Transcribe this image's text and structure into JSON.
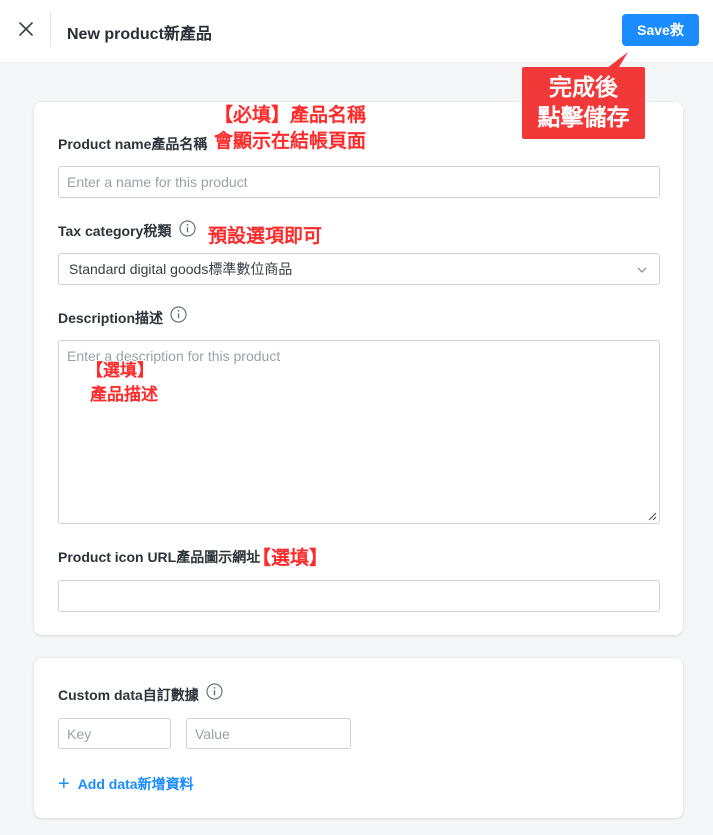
{
  "header": {
    "title": "New product新產品",
    "save_label": "Save救"
  },
  "form": {
    "product_name": {
      "label": "Product name產品名稱",
      "placeholder": "Enter a name for this product",
      "value": ""
    },
    "tax_category": {
      "label": "Tax category稅類",
      "selected": "Standard digital goods標準數位商品"
    },
    "description": {
      "label": "Description描述",
      "placeholder": "Enter a description for this product",
      "value": ""
    },
    "icon_url": {
      "label": "Product icon URL產品圖示網址",
      "value": ""
    }
  },
  "custom_data": {
    "label": "Custom data自訂數據",
    "key_placeholder": "Key",
    "value_placeholder": "Value",
    "add_label": "Add data新增資料"
  },
  "annotations": {
    "save_callout_line1": "完成後",
    "save_callout_line2": "點擊儲存",
    "name_line1": "【必填】產品名稱",
    "name_line2": "會顯示在結帳頁面",
    "tax_note": "預設選項即可",
    "desc_line1": "【選填】",
    "desc_line2": "產品描述",
    "icon_note": "【選填】"
  },
  "colors": {
    "accent": "#1a8cff",
    "annotation": "#ff2a2a",
    "callout_bg": "#f23838"
  },
  "icons": {
    "close": "close-icon",
    "info": "info-icon",
    "chevron": "chevron-down-icon",
    "plus": "plus-icon"
  }
}
